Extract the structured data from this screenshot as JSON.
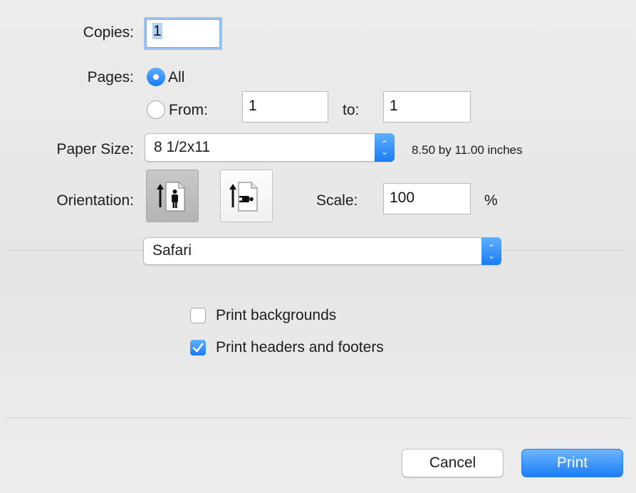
{
  "copies": {
    "label": "Copies:",
    "value": "1"
  },
  "pages": {
    "label": "Pages:",
    "all_label": "All",
    "from_label": "From:",
    "from_value": "1",
    "to_label": "to:",
    "to_value": "1",
    "selected": "All"
  },
  "paper_size": {
    "label": "Paper Size:",
    "value": "8 1/2x11",
    "description": "8.50 by 11.00 inches"
  },
  "orientation": {
    "label": "Orientation:",
    "selected": "portrait",
    "options": [
      "portrait",
      "landscape"
    ]
  },
  "scale": {
    "label": "Scale:",
    "value": "100",
    "unit": "%"
  },
  "section_popup": {
    "value": "Safari"
  },
  "options": [
    {
      "label": "Print backgrounds",
      "checked": false
    },
    {
      "label": "Print headers and footers",
      "checked": true
    }
  ],
  "buttons": {
    "cancel": "Cancel",
    "print": "Print"
  },
  "colors": {
    "accent": "#1a7cf4",
    "focus_ring": "#9cc3f0"
  }
}
